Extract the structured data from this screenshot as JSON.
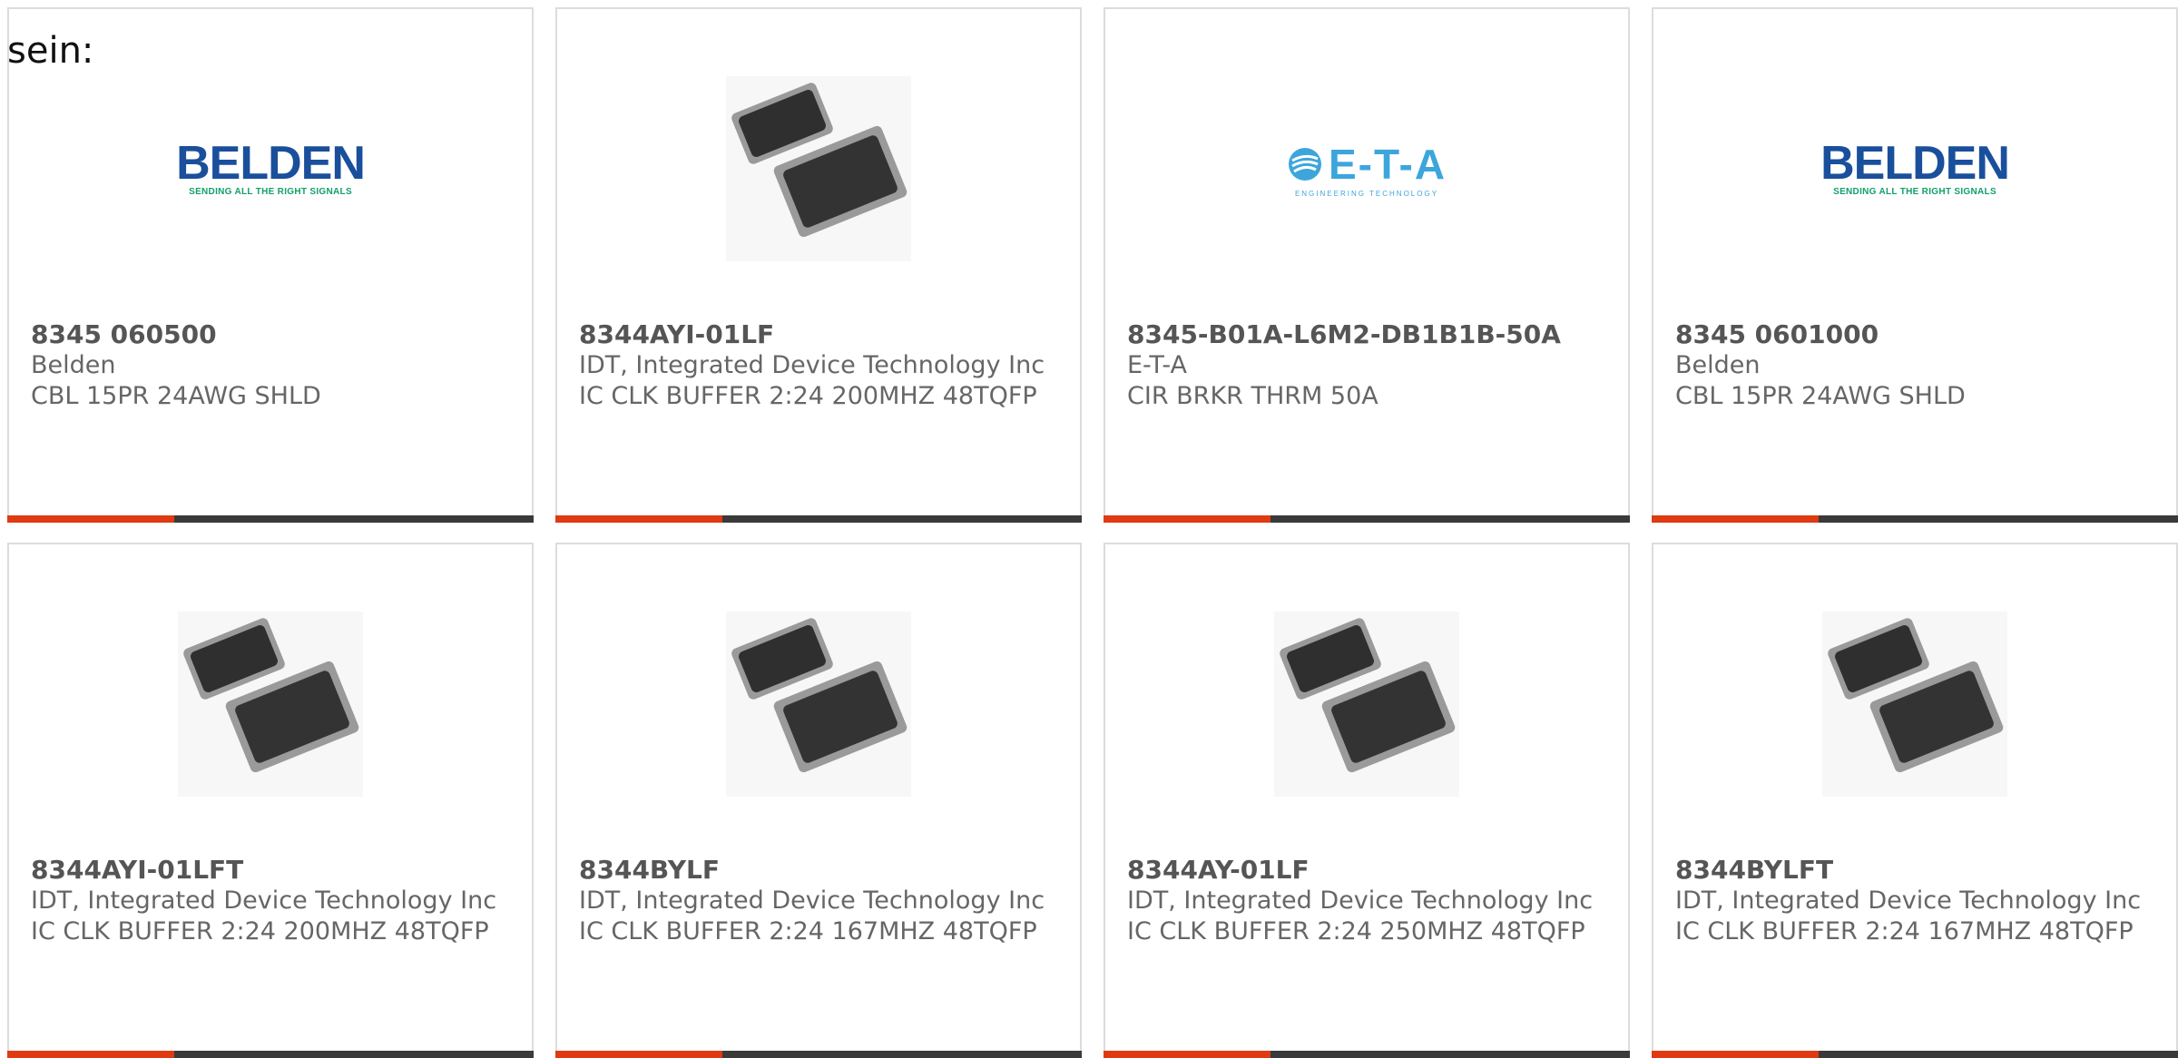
{
  "intro_text": "sein:",
  "colors": {
    "accent": "#e03a12",
    "bar": "#3a3a3a",
    "belden_blue": "#1a4f9c",
    "belden_green": "#12a06a",
    "eta_blue": "#3ca6dc"
  },
  "products": [
    {
      "part_number": "8345 060500",
      "manufacturer": "Belden",
      "description": "CBL 15PR 24AWG SHLD",
      "image": "belden-logo",
      "logo_text": "BELDEN",
      "logo_tagline": "SENDING ALL THE RIGHT SIGNALS"
    },
    {
      "part_number": "8344AYI-01LF",
      "manufacturer": "IDT, Integrated Device Technology Inc",
      "description": "IC CLK BUFFER 2:24 200MHZ 48TQFP",
      "image": "tqfp-chip-icon"
    },
    {
      "part_number": "8345-B01A-L6M2-DB1B1B-50A",
      "manufacturer": "E-T-A",
      "description": "CIR BRKR THRM 50A",
      "image": "eta-logo",
      "logo_text": "E-T-A",
      "logo_tagline": "ENGINEERING TECHNOLOGY"
    },
    {
      "part_number": "8345 0601000",
      "manufacturer": "Belden",
      "description": "CBL 15PR 24AWG SHLD",
      "image": "belden-logo",
      "logo_text": "BELDEN",
      "logo_tagline": "SENDING ALL THE RIGHT SIGNALS"
    },
    {
      "part_number": "8344AYI-01LFT",
      "manufacturer": "IDT, Integrated Device Technology Inc",
      "description": "IC CLK BUFFER 2:24 200MHZ 48TQFP",
      "image": "tqfp-chip-icon"
    },
    {
      "part_number": "8344BYLF",
      "manufacturer": "IDT, Integrated Device Technology Inc",
      "description": "IC CLK BUFFER 2:24 167MHZ 48TQFP",
      "image": "tqfp-chip-icon"
    },
    {
      "part_number": "8344AY-01LF",
      "manufacturer": "IDT, Integrated Device Technology Inc",
      "description": "IC CLK BUFFER 2:24 250MHZ 48TQFP",
      "image": "tqfp-chip-icon"
    },
    {
      "part_number": "8344BYLFT",
      "manufacturer": "IDT, Integrated Device Technology Inc",
      "description": "IC CLK BUFFER 2:24 167MHZ 48TQFP",
      "image": "tqfp-chip-icon"
    }
  ]
}
